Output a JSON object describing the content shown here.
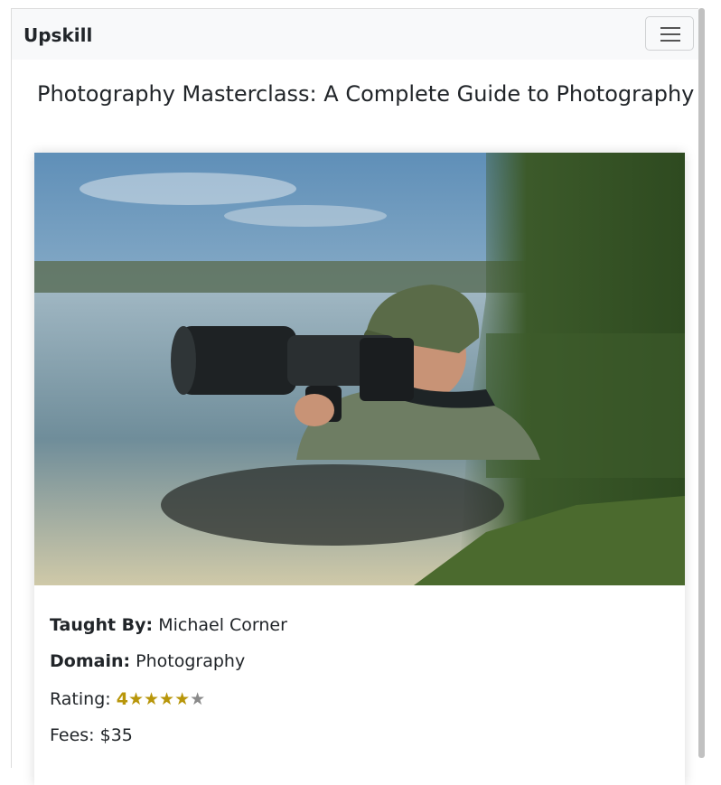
{
  "navbar": {
    "brand": "Upskill",
    "toggle_icon": "hamburger-menu-icon"
  },
  "course": {
    "title": "Photography Masterclass: A Complete Guide to Photography",
    "image_alt": "Photographer with telephoto lens standing in a lake",
    "taught_by_label": "Taught By:",
    "taught_by_value": "Michael Corner",
    "domain_label": "Domain:",
    "domain_value": "Photography",
    "rating_label": "Rating:",
    "rating_value": "4",
    "rating_out_of": 5,
    "fees_label": "Fees:",
    "fees_value": "$35"
  },
  "colors": {
    "navbar_bg": "#f8f9fa",
    "star_filled": "#b8960a",
    "star_empty": "#8a8a8a"
  }
}
